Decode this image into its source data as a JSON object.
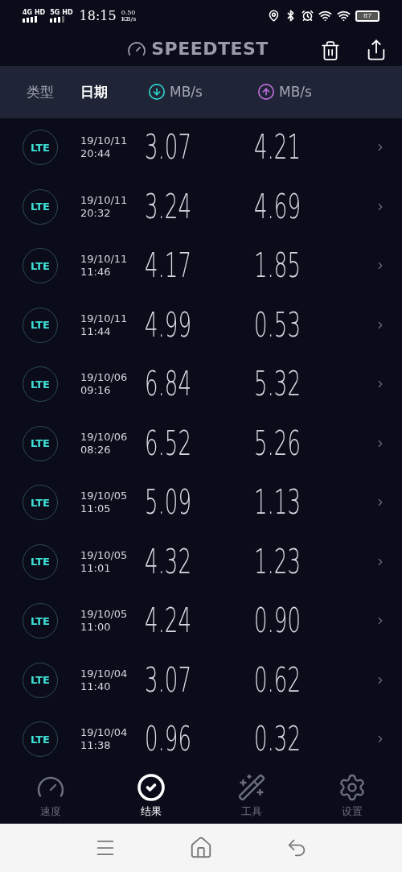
{
  "status_bar": {
    "networks": [
      "4G HD",
      "5G HD"
    ],
    "time": "18:15",
    "speed": "0.50",
    "speed_unit": "KB/s",
    "battery": "87"
  },
  "app_bar": {
    "title": "SPEEDTEST"
  },
  "columns": [
    {
      "label": "类型",
      "kind": "text",
      "selected": false
    },
    {
      "label": "日期",
      "kind": "text",
      "selected": true
    },
    {
      "label": "MB/s",
      "kind": "download",
      "selected": false
    },
    {
      "label": "MB/s",
      "kind": "upload",
      "selected": false
    }
  ],
  "results": [
    {
      "type": "LTE",
      "date": "19/10/11",
      "time": "20:44",
      "download": "3.07",
      "upload": "4.21"
    },
    {
      "type": "LTE",
      "date": "19/10/11",
      "time": "20:32",
      "download": "3.24",
      "upload": "4.69"
    },
    {
      "type": "LTE",
      "date": "19/10/11",
      "time": "11:46",
      "download": "4.17",
      "upload": "1.85"
    },
    {
      "type": "LTE",
      "date": "19/10/11",
      "time": "11:44",
      "download": "4.99",
      "upload": "0.53"
    },
    {
      "type": "LTE",
      "date": "19/10/06",
      "time": "09:16",
      "download": "6.84",
      "upload": "5.32"
    },
    {
      "type": "LTE",
      "date": "19/10/06",
      "time": "08:26",
      "download": "6.52",
      "upload": "5.26"
    },
    {
      "type": "LTE",
      "date": "19/10/05",
      "time": "11:05",
      "download": "5.09",
      "upload": "1.13"
    },
    {
      "type": "LTE",
      "date": "19/10/05",
      "time": "11:01",
      "download": "4.32",
      "upload": "1.23"
    },
    {
      "type": "LTE",
      "date": "19/10/05",
      "time": "11:00",
      "download": "4.24",
      "upload": "0.90"
    },
    {
      "type": "LTE",
      "date": "19/10/04",
      "time": "11:40",
      "download": "3.07",
      "upload": "0.62"
    },
    {
      "type": "LTE",
      "date": "19/10/04",
      "time": "11:38",
      "download": "0.96",
      "upload": "0.32"
    }
  ],
  "bottom_nav": [
    {
      "label": "速度",
      "kind": "speed",
      "selected": false
    },
    {
      "label": "结果",
      "kind": "results",
      "selected": true
    },
    {
      "label": "工具",
      "kind": "tools",
      "selected": false
    },
    {
      "label": "设置",
      "kind": "settings",
      "selected": false
    }
  ]
}
